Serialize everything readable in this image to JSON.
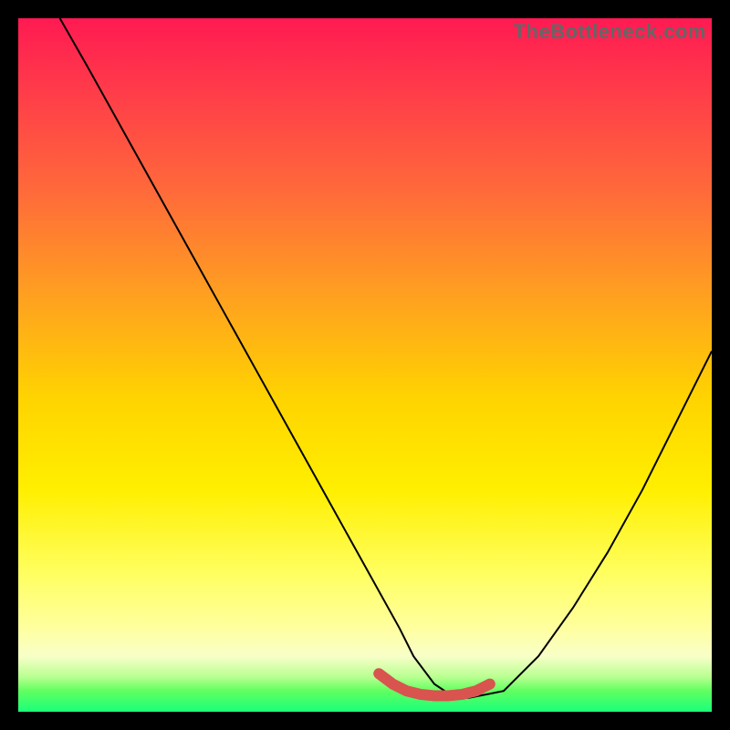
{
  "watermark": "TheBottleneck.com",
  "chart_data": {
    "type": "line",
    "title": "",
    "xlabel": "",
    "ylabel": "",
    "xlim": [
      0,
      100
    ],
    "ylim": [
      0,
      100
    ],
    "series": [
      {
        "name": "curve",
        "x": [
          6,
          10,
          15,
          20,
          25,
          30,
          35,
          40,
          45,
          50,
          55,
          57,
          60,
          63,
          65,
          70,
          75,
          80,
          85,
          90,
          95,
          100
        ],
        "y": [
          100,
          93,
          84,
          75,
          66,
          57,
          48,
          39,
          30,
          21,
          12,
          8,
          4,
          2,
          2,
          3,
          8,
          15,
          23,
          32,
          42,
          52
        ]
      },
      {
        "name": "highlight",
        "x": [
          52,
          54,
          56,
          58,
          60,
          62,
          64,
          66,
          68
        ],
        "y": [
          5.5,
          4.0,
          3.0,
          2.5,
          2.3,
          2.3,
          2.5,
          3.0,
          4.0
        ]
      }
    ],
    "colors": {
      "curve": "#000000",
      "highlight": "#d9534f"
    }
  }
}
